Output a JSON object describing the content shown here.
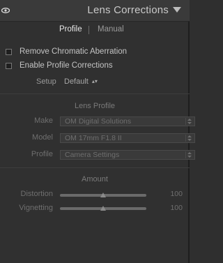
{
  "header": {
    "title": "Lens Corrections",
    "eye_icon": "eye-icon",
    "collapse_icon": "triangle-down-icon"
  },
  "tabs": [
    {
      "label": "Profile",
      "active": true
    },
    {
      "label": "Manual",
      "active": false
    }
  ],
  "checkboxes": [
    {
      "label": "Remove Chromatic Aberration",
      "checked": false
    },
    {
      "label": "Enable Profile Corrections",
      "checked": false
    }
  ],
  "setup": {
    "label": "Setup",
    "value": "Default"
  },
  "lens_profile": {
    "title": "Lens Profile",
    "fields": [
      {
        "label": "Make",
        "value": "OM Digital Solutions"
      },
      {
        "label": "Model",
        "value": "OM 17mm F1.8 II"
      },
      {
        "label": "Profile",
        "value": "Camera Settings"
      }
    ]
  },
  "amount": {
    "title": "Amount",
    "sliders": [
      {
        "label": "Distortion",
        "value": "100",
        "position": 0.5
      },
      {
        "label": "Vignetting",
        "value": "100",
        "position": 0.5
      }
    ]
  },
  "colors": {
    "panel_bg": "#303030",
    "header_bg": "#3a3a3a",
    "text_active": "#e8e8e8",
    "text_muted": "#6f6f6f"
  }
}
